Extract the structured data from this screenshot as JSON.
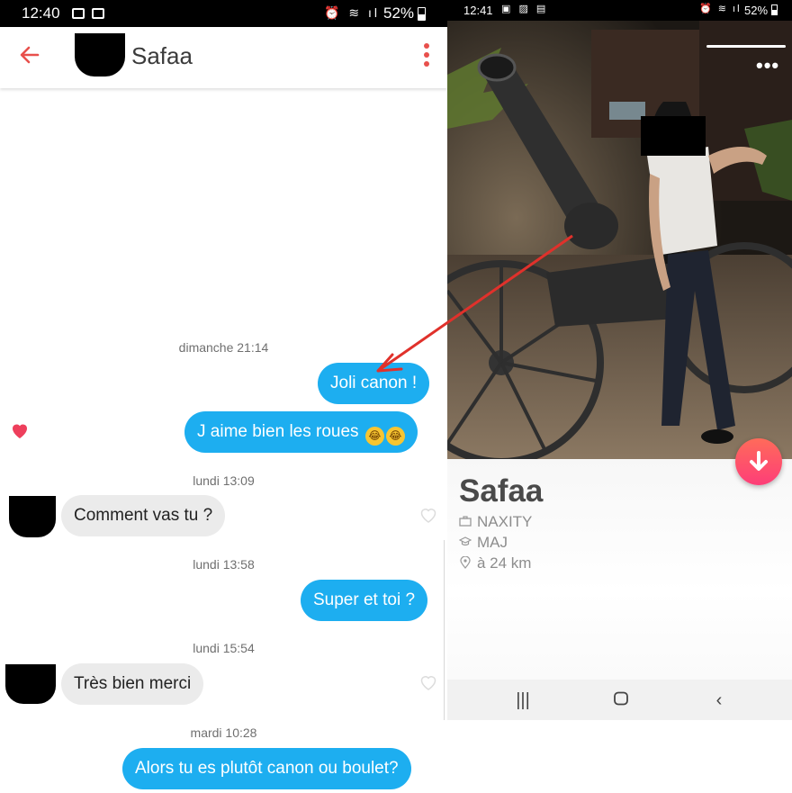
{
  "left": {
    "status": {
      "time": "12:40",
      "battery": "52%"
    },
    "header": {
      "name": "Safaa"
    },
    "messages": [
      {
        "ts": "dimanche 21:14"
      },
      {
        "text": "Joli canon !",
        "dir": "out"
      },
      {
        "text": "J aime bien les roues",
        "dir": "out",
        "emoji": "🤣🤣"
      },
      {
        "ts": "lundi 13:09"
      },
      {
        "text": "Comment vas tu ?",
        "dir": "in"
      },
      {
        "ts": "lundi 13:58"
      },
      {
        "text": "Super et toi ?",
        "dir": "out"
      },
      {
        "ts": "lundi 15:54"
      },
      {
        "text": "Très bien merci",
        "dir": "in"
      },
      {
        "ts": "mardi 10:28"
      },
      {
        "text": "Alors tu es plutôt canon ou boulet?",
        "dir": "out"
      }
    ]
  },
  "right": {
    "status": {
      "time": "12:41",
      "battery": "52%"
    },
    "profile": {
      "name": "Safaa",
      "job": "NAXITY",
      "school": "MAJ",
      "distance": "à 24 km"
    }
  },
  "icons": {
    "back": "back-arrow-icon",
    "menu": "kebab-menu-icon",
    "like": "heart-icon",
    "down": "arrow-down-icon",
    "job": "briefcase-icon",
    "school": "graduation-cap-icon",
    "location": "location-pin-icon"
  },
  "colors": {
    "accent": "#e8504c",
    "outgoing": "#1daef0",
    "incoming": "#ebebeb",
    "tinder": "#fd3e78"
  }
}
